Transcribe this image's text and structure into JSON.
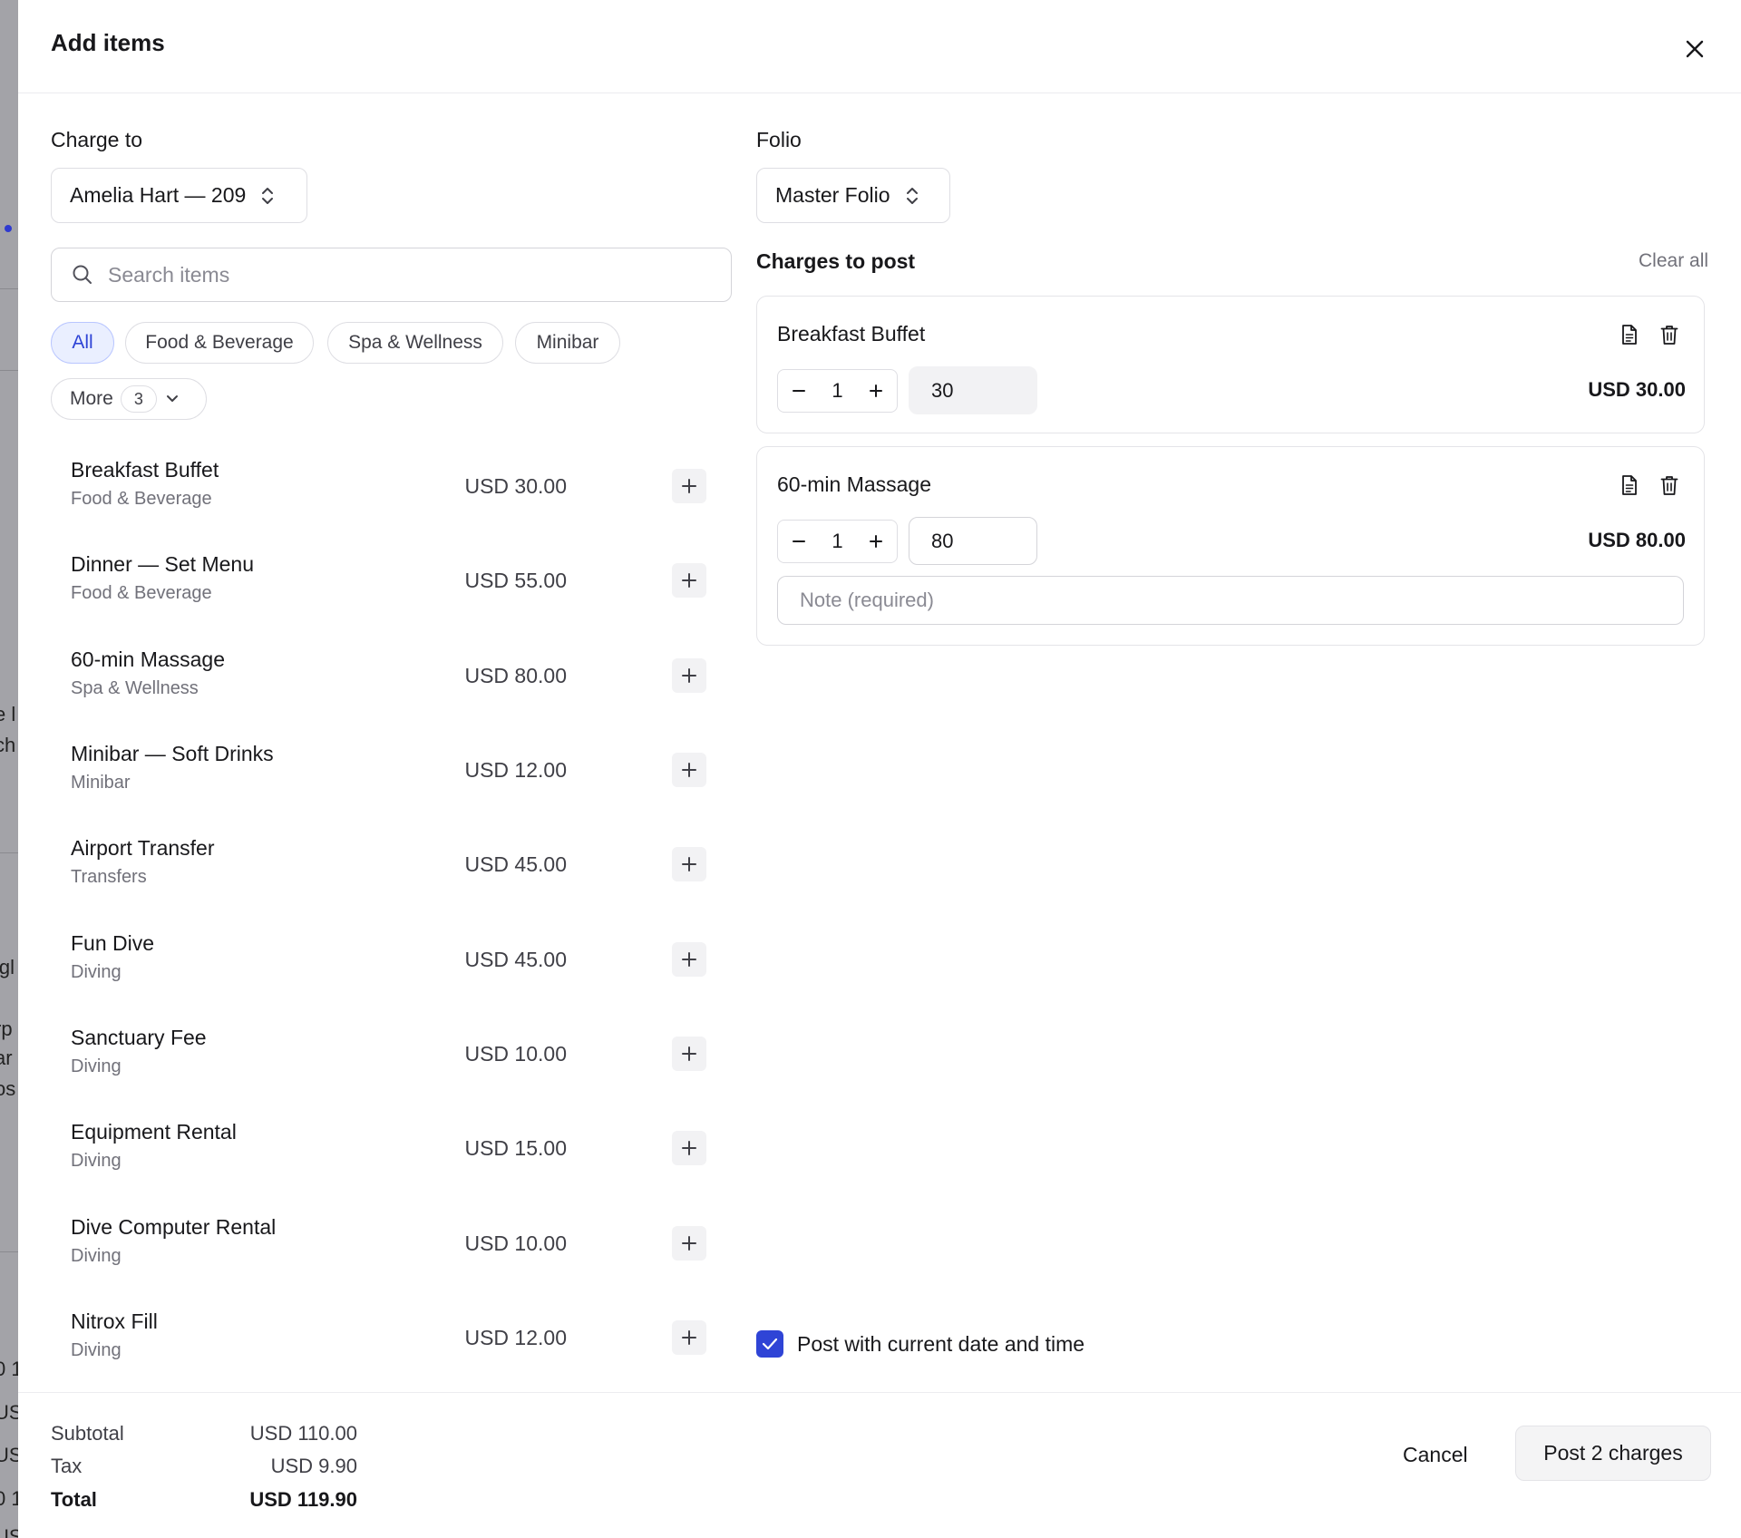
{
  "backdrop": {
    "fragments": [
      "e l",
      "ch",
      "igl",
      "rp",
      "ar",
      "os",
      "0 1",
      "US",
      "US",
      "0 1",
      "US"
    ]
  },
  "modal": {
    "title": "Add items",
    "close_icon": "close-icon"
  },
  "charge_to": {
    "label": "Charge to",
    "value": "Amelia Hart — 209"
  },
  "folio": {
    "label": "Folio",
    "value": "Master Folio"
  },
  "search": {
    "placeholder": "Search items"
  },
  "filters": {
    "chips": [
      "All",
      "Food & Beverage",
      "Spa & Wellness",
      "Minibar"
    ],
    "active": "All",
    "more_label": "More",
    "more_count": "3"
  },
  "items": [
    {
      "name": "Breakfast Buffet",
      "category": "Food & Beverage",
      "price": "USD 30.00"
    },
    {
      "name": "Dinner — Set Menu",
      "category": "Food & Beverage",
      "price": "USD 55.00"
    },
    {
      "name": "60-min Massage",
      "category": "Spa & Wellness",
      "price": "USD 80.00"
    },
    {
      "name": "Minibar — Soft Drinks",
      "category": "Minibar",
      "price": "USD 12.00"
    },
    {
      "name": "Airport Transfer",
      "category": "Transfers",
      "price": "USD 45.00"
    },
    {
      "name": "Fun Dive",
      "category": "Diving",
      "price": "USD 45.00"
    },
    {
      "name": "Sanctuary Fee",
      "category": "Diving",
      "price": "USD 10.00"
    },
    {
      "name": "Equipment Rental",
      "category": "Diving",
      "price": "USD 15.00"
    },
    {
      "name": "Dive Computer Rental",
      "category": "Diving",
      "price": "USD 10.00"
    },
    {
      "name": "Nitrox Fill",
      "category": "Diving",
      "price": "USD 12.00"
    }
  ],
  "charges": {
    "title": "Charges to post",
    "clear_label": "Clear all",
    "lines": [
      {
        "name": "Breakfast Buffet",
        "qty": "1",
        "unit_price": "30",
        "total": "USD 30.00"
      },
      {
        "name": "60-min Massage",
        "qty": "1",
        "unit_price": "80",
        "total": "USD 80.00",
        "note_placeholder": "Note (required)"
      }
    ]
  },
  "post_now": {
    "label": "Post with current date and time",
    "checked": true
  },
  "totals": {
    "subtotal_label": "Subtotal",
    "subtotal": "USD 110.00",
    "tax_label": "Tax",
    "tax": "USD 9.90",
    "total_label": "Total",
    "total": "USD 119.90"
  },
  "actions": {
    "cancel": "Cancel",
    "post": "Post 2 charges"
  },
  "colors": {
    "accent": "#2f44d6",
    "active_chip_bg": "#eaefff",
    "muted_text": "#71717a",
    "border": "#dedee3"
  }
}
